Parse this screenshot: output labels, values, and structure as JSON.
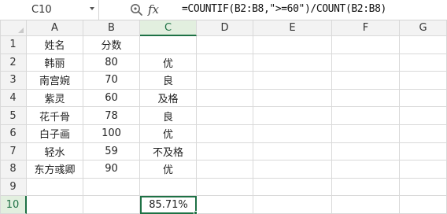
{
  "formula_bar": {
    "name_box": "C10",
    "fx_label": "fx",
    "formula": "=COUNTIF(B2:B8,\">=60\")/COUNT(B2:B8)"
  },
  "grid": {
    "columns": [
      "A",
      "B",
      "C",
      "D",
      "E",
      "F",
      "G"
    ],
    "rows": [
      "1",
      "2",
      "3",
      "4",
      "5",
      "6",
      "7",
      "8",
      "9",
      "10"
    ],
    "cells": [
      [
        "姓名",
        "分数",
        "",
        "",
        "",
        "",
        ""
      ],
      [
        "韩丽",
        "80",
        "优",
        "",
        "",
        "",
        ""
      ],
      [
        "南宫婉",
        "70",
        "良",
        "",
        "",
        "",
        ""
      ],
      [
        "紫灵",
        "60",
        "及格",
        "",
        "",
        "",
        ""
      ],
      [
        "花千骨",
        "78",
        "良",
        "",
        "",
        "",
        ""
      ],
      [
        "白子画",
        "100",
        "优",
        "",
        "",
        "",
        ""
      ],
      [
        "轻水",
        "59",
        "不及格",
        "",
        "",
        "",
        ""
      ],
      [
        "东方彧卿",
        "90",
        "优",
        "",
        "",
        "",
        ""
      ],
      [
        "",
        "",
        "",
        "",
        "",
        "",
        ""
      ],
      [
        "",
        "",
        "85.71%",
        "",
        "",
        "",
        ""
      ]
    ],
    "selected_column": "C",
    "selected_row": "10"
  },
  "colors": {
    "accent": "#1e7145",
    "header_bg": "#f3f3f3",
    "selected_header_bg": "#e2efdf",
    "gridline": "#d9d9d9"
  }
}
